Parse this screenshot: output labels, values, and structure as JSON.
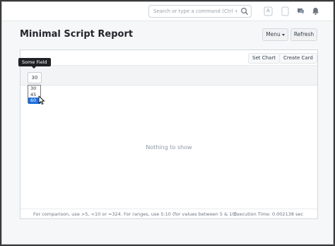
{
  "navbar": {
    "search_placeholder": "Search or type a command (Ctrl + G)",
    "icons": [
      "search-icon",
      "avatar-icon",
      "help-icon",
      "chat-icon",
      "notification-bell-icon"
    ],
    "avatar_letter": "A"
  },
  "header": {
    "title": "Minimal Script Report",
    "menu_label": "Menu",
    "refresh_label": "Refresh"
  },
  "report": {
    "set_chart_label": "Set Chart",
    "create_card_label": "Create Card",
    "filter": {
      "tooltip": "Some Field",
      "value": "30",
      "options": [
        "30",
        "45",
        "60"
      ],
      "highlighted": "60"
    },
    "empty_message": "Nothing to show",
    "footer_help": "For comparison, use >5, <10 or =324. For ranges, use 5:10 (for values between 5 & 10).",
    "execution_time": "Execution Time: 0.002138 sec"
  },
  "colors": {
    "accent": "#1e70e0",
    "tooltip_bg": "#1f2124",
    "page_bg": "#f6f7f8"
  }
}
